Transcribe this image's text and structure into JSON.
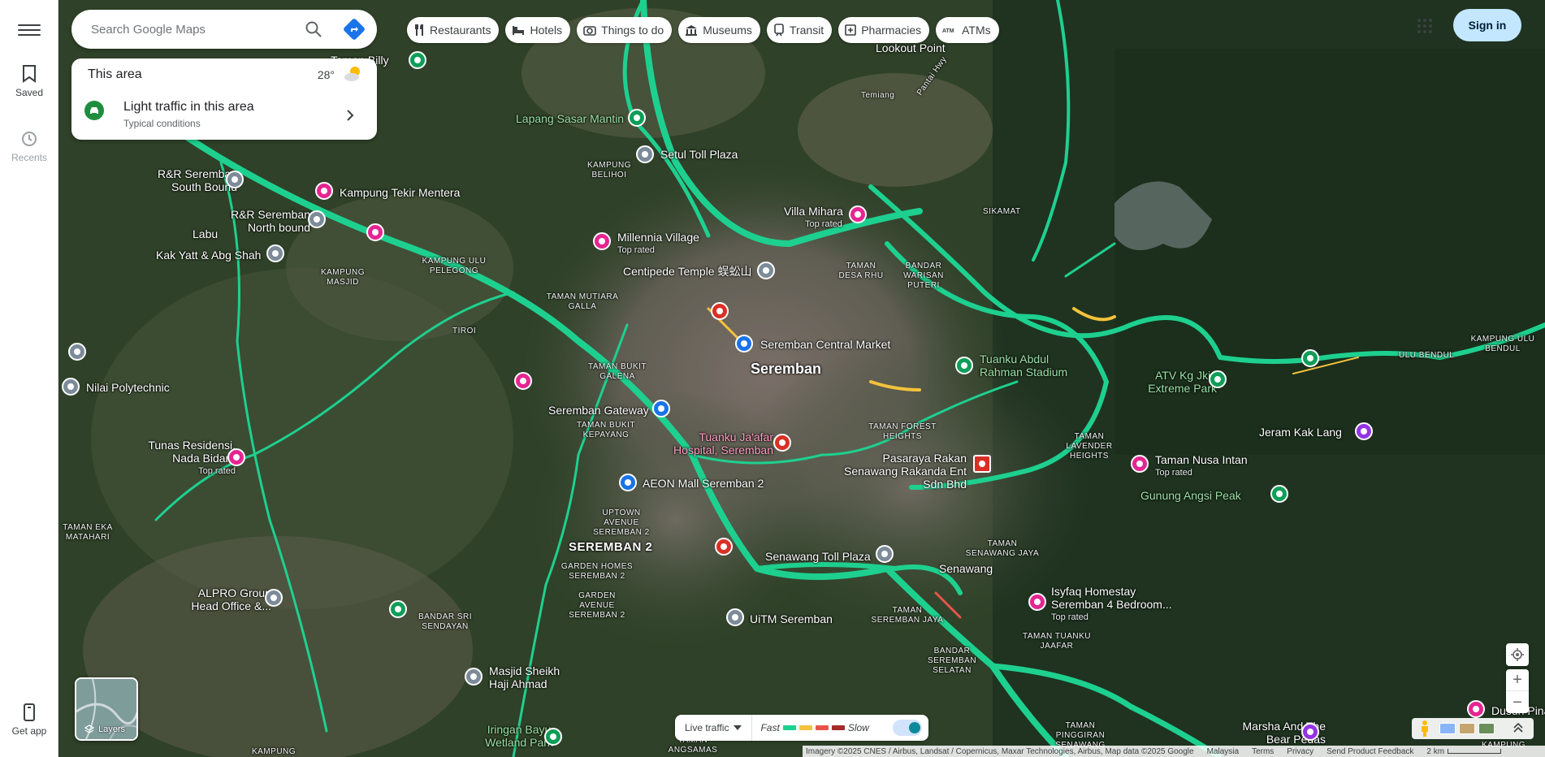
{
  "rail": {
    "saved_label": "Saved",
    "recents_label": "Recents",
    "getapp_label": "Get app"
  },
  "search": {
    "placeholder": "Search Google Maps"
  },
  "area": {
    "title": "This area",
    "temperature": "28°",
    "traffic_title": "Light traffic in this area",
    "traffic_sub": "Typical conditions"
  },
  "chips": [
    {
      "label": "Restaurants",
      "icon": "fork-knife-icon"
    },
    {
      "label": "Hotels",
      "icon": "bed-icon"
    },
    {
      "label": "Things to do",
      "icon": "camera-icon"
    },
    {
      "label": "Museums",
      "icon": "museum-icon"
    },
    {
      "label": "Transit",
      "icon": "train-icon"
    },
    {
      "label": "Pharmacies",
      "icon": "pharmacy-icon"
    },
    {
      "label": "ATMs",
      "icon": "atm-icon"
    }
  ],
  "header": {
    "signin_label": "Sign in"
  },
  "places": {
    "alam_sutun_billy": "Taman Billy",
    "lookout_point": "Lookout Point",
    "temiang": "Temiang",
    "pantai_hwy": "Pantai Hwy",
    "lapang_sasar": "Lapang Sasar Mantin",
    "seremban_toll": "Setul Toll Plaza",
    "kampung_belihoi": "KAMPUNG BELIHOI",
    "rr_south": "R&R Seremban South Bound",
    "kampung_tekir": "Kampung Tekir Mentera",
    "rr_north": "R&R Seremban North bound",
    "labu": "Labu",
    "villa_mihara": "Villa Mihara",
    "villa_mihara_sub": "Top rated",
    "sikamat": "SIKAMAT",
    "kak_yatt": "Kak Yatt & Abg Shah",
    "kampung_ulu_pelegong": "KAMPUNG ULU PELEGONG",
    "kampung_masjid": "KAMPUNG MASJID",
    "millennia": "Millennia Village",
    "millennia_sub": "Top rated",
    "centipede": "Centipede Temple 蜈蚣山",
    "taman_desa_rhu": "TAMAN DESA RHU",
    "bandar_warisan": "BANDAR WARISAN PUTERI",
    "taman_mutiara": "TAMAN MUTIARA GALLA",
    "tiroi": "TIROI",
    "seremban_central": "Seremban Central Market",
    "seremban": "Seremban",
    "tuanku_abdul": "Tuanku Abdul Rahman Stadium",
    "nilai_poly": "Nilai Polytechnic",
    "taman_bukit_galena": "TAMAN BUKIT GALENA",
    "seremban_gateway": "Seremban Gateway",
    "taman_bukit_kepayang": "TAMAN BUKIT KEPAYANG",
    "tuanku_jaafar": "Tuanku Ja'afar Hospital, Seremban",
    "taman_forest": "TAMAN FOREST HEIGHTS",
    "pasaraya": "Pasaraya Rakan Senawang Rakanda Ent Sdn Bhd",
    "atv": "ATV Kg Jkin Extreme Park",
    "ulu_bendul": "ULU BENDUL",
    "kampung_ulu_bendul": "KAMPUNG ULU BENDUL",
    "jeram": "Jeram Kak Lang",
    "tunas": "Tunas Residensi, Nada Bidara",
    "tunas_sub": "Top rated",
    "aeon": "AEON Mall Seremban 2",
    "taman_lavender": "TAMAN LAVENDER HEIGHTS",
    "taman_nusa": "Taman Nusa Intan",
    "taman_nusa_sub": "Top rated",
    "gunung_angsi": "Gunung Angsi Peak",
    "taman_eka": "TAMAN EKA MATAHARI",
    "uptown": "UPTOWN AVENUE SEREMBAN 2",
    "seremban2": "SEREMBAN 2",
    "senawang_toll": "Senawang Toll Plaza",
    "taman_senawang_jaya": "TAMAN SENAWANG JAYA",
    "senawang": "Senawang",
    "garden_homes": "GARDEN HOMES SEREMBAN 2",
    "alpro": "ALPRO Group Head Office &...",
    "bandar_sri": "BANDAR SRI SENDAYAN",
    "garden_avenue": "GARDEN AVENUE SEREMBAN 2",
    "isyfaq": "Isyfaq Homestay Seremban 4 Bedroom...",
    "isyfaq_sub": "Top rated",
    "uitm": "UiTM Seremban",
    "taman_seremban_jaya": "TAMAN SEREMBAN JAYA",
    "taman_tuanku": "TAMAN TUANKU JAAFAR",
    "bandar_seremban_selatan": "BANDAR SEREMBAN SELATAN",
    "masjid": "Masjid Sheikh Haji Ahmad",
    "marsha": "Marsha And The Bear Pedas",
    "iringan": "Iringan Bayu Wetland Park",
    "taman_angsamas": "TAMAN ANGSAMAS",
    "taman_pinggiran": "TAMAN PINGGIRAN SENAWANG",
    "kampung_bottom": "KAMPUNG",
    "dusun": "Dusun Pina",
    "kampung_br": "KAMPUNG"
  },
  "layers_label": "Layers",
  "legend": {
    "mode": "Live traffic",
    "fast": "Fast",
    "slow": "Slow",
    "colors": [
      "#1ed08f",
      "#f4c23b",
      "#e8544a",
      "#a52a2a"
    ]
  },
  "footer": {
    "attribution": "Imagery ©2025 CNES / Airbus, Landsat / Copernicus, Maxar Technologies, Airbus, Map data ©2025 Google",
    "country": "Malaysia",
    "terms": "Terms",
    "privacy": "Privacy",
    "feedback": "Send Product Feedback",
    "scale": "2 km"
  },
  "colors": {
    "road": "#1ed08f",
    "signin_bg": "#c2e7ff",
    "accent": "#1a73e8"
  }
}
